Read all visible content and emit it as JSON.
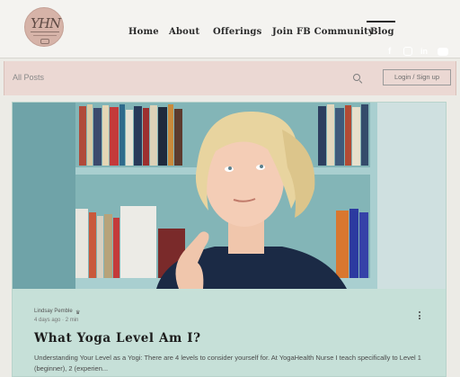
{
  "header": {
    "logo_text": "YHN",
    "nav": [
      {
        "label": "Home",
        "active": false
      },
      {
        "label": "About",
        "active": false
      },
      {
        "label": "Offerings",
        "active": false
      },
      {
        "label": "Join FB Community",
        "active": false
      },
      {
        "label": "Blog",
        "active": true
      }
    ],
    "social_icons": [
      "facebook-icon",
      "instagram-icon",
      "linkedin-icon",
      "youtube-icon"
    ]
  },
  "filter_bar": {
    "all_posts_label": "All Posts",
    "login_label": "Login / Sign up"
  },
  "post": {
    "author": "Lindsay Pemble",
    "date": "4 days ago",
    "read_time": "2 min",
    "title": "What Yoga Level Am I?",
    "excerpt": "Understanding Your Level as a Yogi: There are 4 levels to consider yourself for. At YogaHealth Nurse I teach specifically to Level 1 (beginner), 2 (experien..."
  },
  "colors": {
    "header_bg": "#f4f3f0",
    "filter_bar_bg": "#ebd8d3",
    "card_bg": "#c6e0d8",
    "logo_bg": "#d6b3a8",
    "shelf": "#7fb0b4"
  }
}
